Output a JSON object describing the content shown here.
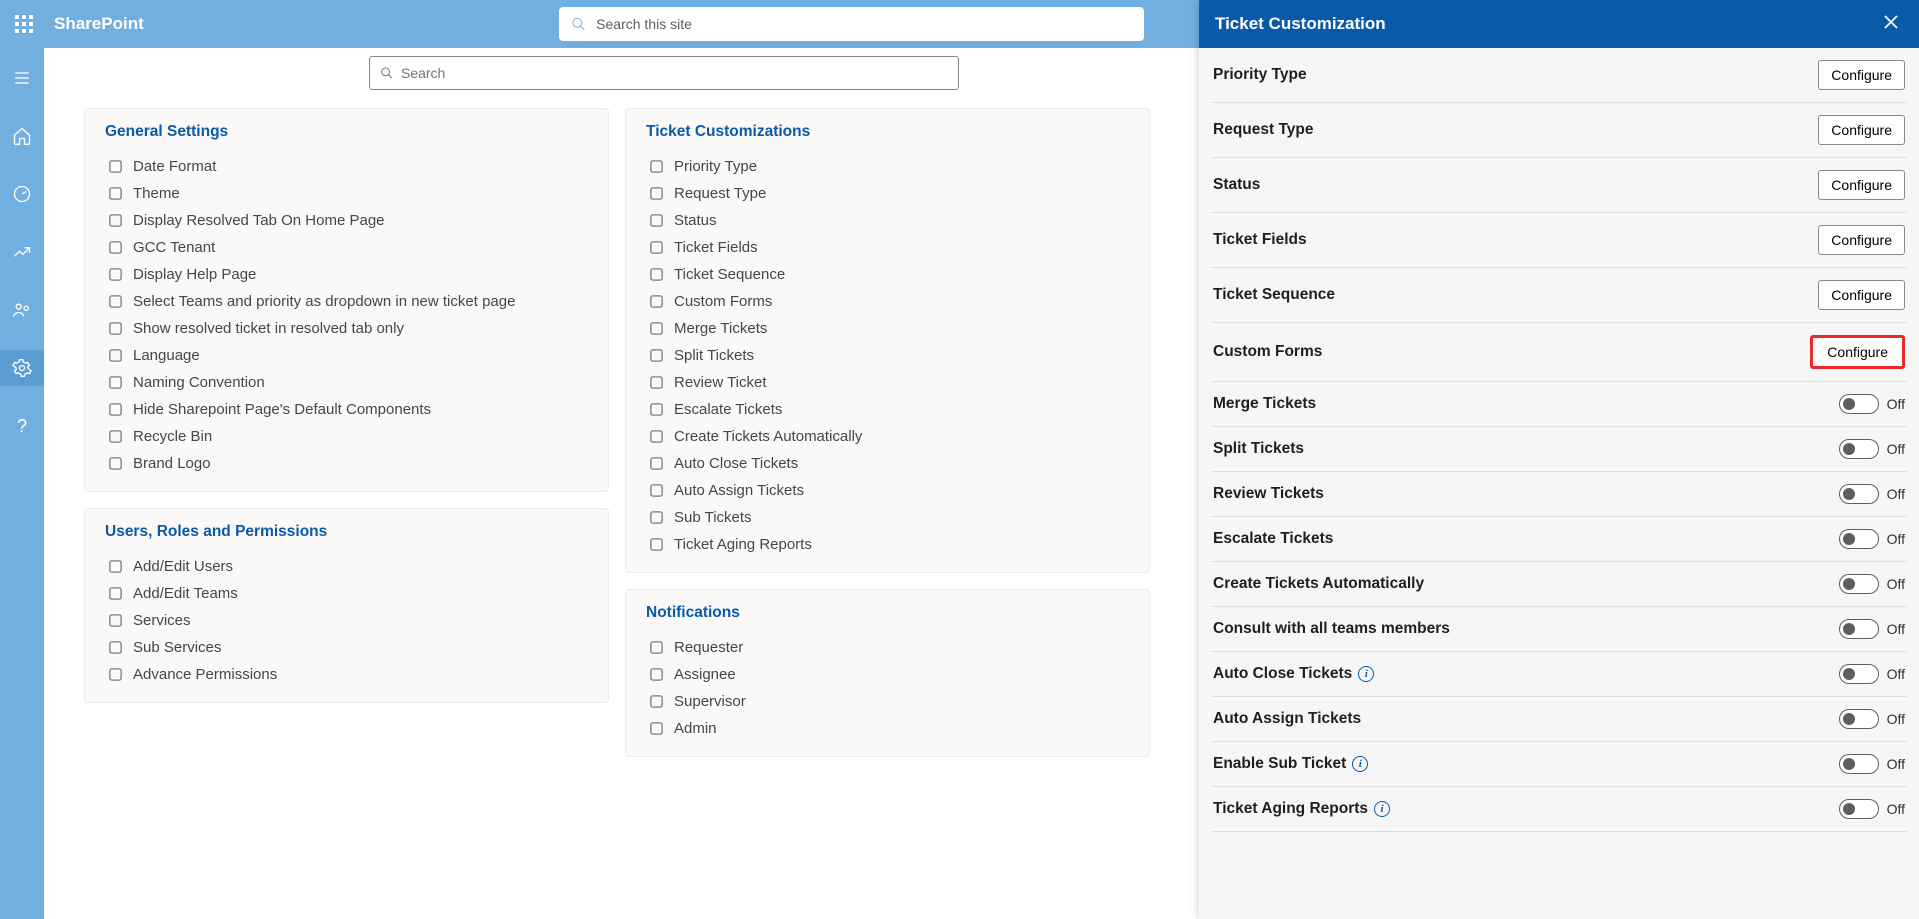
{
  "header": {
    "brand": "SharePoint",
    "search_placeholder": "Search this site"
  },
  "filter": {
    "placeholder": "Search"
  },
  "cards": {
    "general": {
      "title": "General Settings",
      "items": [
        "Date Format",
        "Theme",
        "Display Resolved Tab On Home Page",
        "GCC Tenant",
        "Display Help Page",
        "Select Teams and priority as dropdown in new ticket page",
        "Show resolved ticket in resolved tab only",
        "Language",
        "Naming Convention",
        "Hide Sharepoint Page's Default Components",
        "Recycle Bin",
        "Brand Logo"
      ]
    },
    "users": {
      "title": "Users, Roles and Permissions",
      "items": [
        "Add/Edit Users",
        "Add/Edit Teams",
        "Services",
        "Sub Services",
        "Advance Permissions"
      ]
    },
    "ticket": {
      "title": "Ticket Customizations",
      "items": [
        "Priority Type",
        "Request Type",
        "Status",
        "Ticket Fields",
        "Ticket Sequence",
        "Custom Forms",
        "Merge Tickets",
        "Split Tickets",
        "Review Ticket",
        "Escalate Tickets",
        "Create Tickets Automatically",
        "Auto Close Tickets",
        "Auto Assign Tickets",
        "Sub Tickets",
        "Ticket Aging Reports"
      ]
    },
    "notifications": {
      "title": "Notifications",
      "items": [
        "Requester",
        "Assignee",
        "Supervisor",
        "Admin"
      ]
    }
  },
  "panel": {
    "title": "Ticket Customization",
    "configure_label": "Configure",
    "off_label": "Off",
    "config_rows": [
      "Priority Type",
      "Request Type",
      "Status",
      "Ticket Fields",
      "Ticket Sequence",
      "Custom Forms"
    ],
    "toggle_rows": [
      {
        "label": "Merge Tickets",
        "info": false
      },
      {
        "label": "Split Tickets",
        "info": false
      },
      {
        "label": "Review Tickets",
        "info": false
      },
      {
        "label": "Escalate Tickets",
        "info": false
      },
      {
        "label": "Create Tickets Automatically",
        "info": false
      },
      {
        "label": "Consult with all teams members",
        "info": false
      },
      {
        "label": "Auto Close Tickets",
        "info": true
      },
      {
        "label": "Auto Assign Tickets",
        "info": false
      },
      {
        "label": "Enable Sub Ticket",
        "info": true
      },
      {
        "label": "Ticket Aging Reports",
        "info": true
      }
    ],
    "highlight_index": 5
  }
}
